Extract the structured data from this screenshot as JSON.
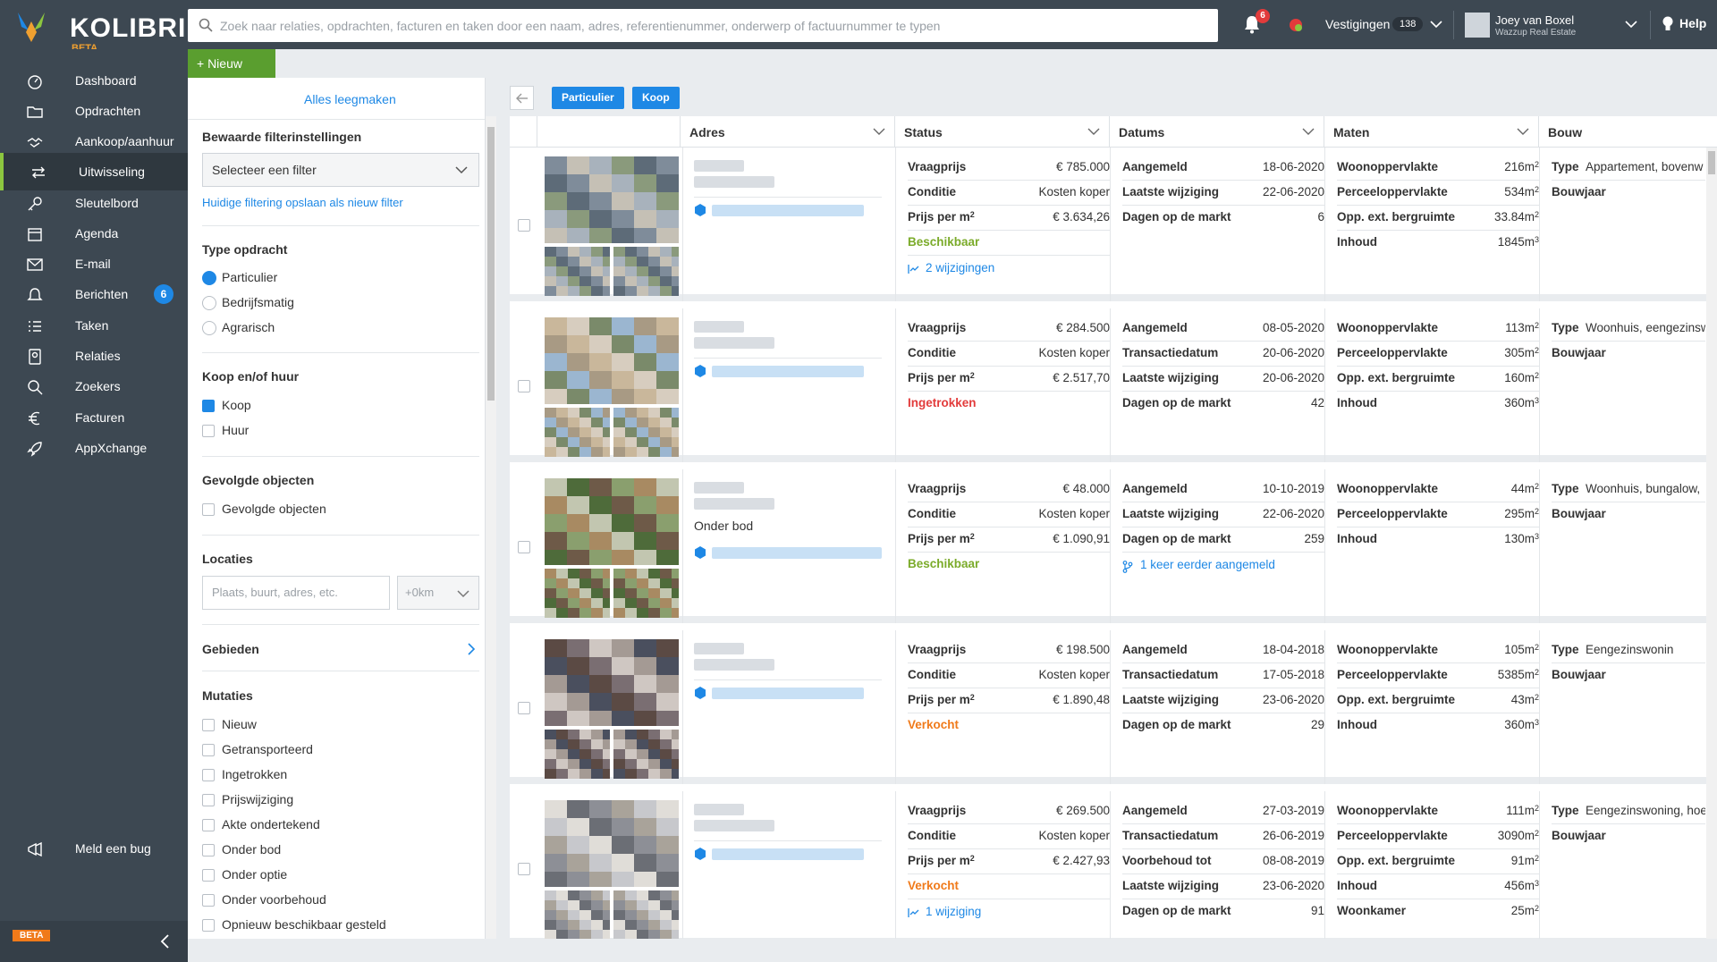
{
  "app": {
    "name": "KOLIBRI",
    "beta": "BETA"
  },
  "search": {
    "placeholder": "Zoek naar relaties, opdrachten, facturen en taken door een naam, adres, referentienummer, onderwerp of factuurnummer te typen"
  },
  "topbar": {
    "notification_count": "6",
    "vestigingen_label": "Vestigingen",
    "vestigingen_count": "138",
    "user_name": "Joey van Boxel",
    "user_company": "Wazzup Real Estate",
    "help": "Help"
  },
  "sidebar": {
    "items": [
      {
        "label": "Dashboard",
        "icon": "dashboard-icon"
      },
      {
        "label": "Opdrachten",
        "icon": "folder-icon"
      },
      {
        "label": "Aankoop/aanhuur",
        "icon": "handshake-icon"
      },
      {
        "label": "Uitwisseling",
        "icon": "exchange-icon"
      },
      {
        "label": "Sleutelbord",
        "icon": "key-icon"
      },
      {
        "label": "Agenda",
        "icon": "calendar-icon"
      },
      {
        "label": "E-mail",
        "icon": "mail-icon"
      },
      {
        "label": "Berichten",
        "icon": "bell-icon",
        "count": "6"
      },
      {
        "label": "Taken",
        "icon": "tasks-icon"
      },
      {
        "label": "Relaties",
        "icon": "contacts-icon"
      },
      {
        "label": "Zoekers",
        "icon": "search-icon"
      },
      {
        "label": "Facturen",
        "icon": "euro-icon"
      },
      {
        "label": "AppXchange",
        "icon": "rocket-icon"
      }
    ],
    "bug": "Meld een bug",
    "beta_flag": "BETA"
  },
  "new_button": "+ Nieuw",
  "filter": {
    "clear": "Alles leegmaken",
    "saved_title": "Bewaarde filterinstellingen",
    "saved_select": "Selecteer een filter",
    "save_link": "Huidige filtering opslaan als nieuw filter",
    "type_title": "Type opdracht",
    "type_options": [
      "Particulier",
      "Bedrijfsmatig",
      "Agrarisch"
    ],
    "koop_title": "Koop en/of huur",
    "koop_options": [
      "Koop",
      "Huur"
    ],
    "gevolgd_title": "Gevolgde objecten",
    "gevolgd_option": "Gevolgde objecten",
    "loc_title": "Locaties",
    "loc_placeholder": "Plaats, buurt, adres, etc.",
    "loc_km": "+0km",
    "gebieden": "Gebieden",
    "mutaties_title": "Mutaties",
    "mutaties": [
      "Nieuw",
      "Getransporteerd",
      "Ingetrokken",
      "Prijswijziging",
      "Akte ondertekend",
      "Onder bod",
      "Onder optie",
      "Onder voorbehoud",
      "Opnieuw beschikbaar gesteld"
    ]
  },
  "chips": [
    "Particulier",
    "Koop"
  ],
  "columns": [
    "Adres",
    "Status",
    "Datums",
    "Maten",
    "Bouw"
  ],
  "rows": [
    {
      "extra_line": "",
      "status": [
        [
          "Vraagprijs",
          "€ 785.000"
        ],
        [
          "Conditie",
          "Kosten koper"
        ],
        [
          "Prijs per m",
          "€ 3.634,26"
        ]
      ],
      "status_label": "Beschikbaar",
      "status_color": "green",
      "status_link": "2 wijzigingen",
      "dates": [
        [
          "Aangemeld",
          "18-06-2020"
        ],
        [
          "Laatste wijziging",
          "22-06-2020"
        ],
        [
          "Dagen op de markt",
          "6"
        ]
      ],
      "date_link": "",
      "sizes": [
        [
          "Woonoppervlakte",
          "216m",
          "2"
        ],
        [
          "Perceeloppervlakte",
          "534m",
          "2"
        ],
        [
          "Opp. ext. bergruimte",
          "33.84m",
          "2"
        ],
        [
          "Inhoud",
          "1845m",
          "3"
        ]
      ],
      "bouw_type_label": "Type",
      "bouw_type": "Appartement, bovenw",
      "bouwjaar": "Bouwjaar"
    },
    {
      "extra_line": "",
      "status": [
        [
          "Vraagprijs",
          "€ 284.500"
        ],
        [
          "Conditie",
          "Kosten koper"
        ],
        [
          "Prijs per m",
          "€ 2.517,70"
        ]
      ],
      "status_label": "Ingetrokken",
      "status_color": "red",
      "status_link": "",
      "dates": [
        [
          "Aangemeld",
          "08-05-2020"
        ],
        [
          "Transactiedatum",
          "20-06-2020"
        ],
        [
          "Laatste wijziging",
          "20-06-2020"
        ],
        [
          "Dagen op de markt",
          "42"
        ]
      ],
      "date_link": "",
      "sizes": [
        [
          "Woonoppervlakte",
          "113m",
          "2"
        ],
        [
          "Perceeloppervlakte",
          "305m",
          "2"
        ],
        [
          "Opp. ext. bergruimte",
          "160m",
          "2"
        ],
        [
          "Inhoud",
          "360m",
          "3"
        ]
      ],
      "bouw_type_label": "Type",
      "bouw_type": "Woonhuis, eengezinsw",
      "bouwjaar": "Bouwjaar"
    },
    {
      "extra_line": "Onder bod",
      "status": [
        [
          "Vraagprijs",
          "€ 48.000"
        ],
        [
          "Conditie",
          "Kosten koper"
        ],
        [
          "Prijs per m",
          "€ 1.090,91"
        ]
      ],
      "status_label": "Beschikbaar",
      "status_color": "green",
      "status_link": "",
      "dates": [
        [
          "Aangemeld",
          "10-10-2019"
        ],
        [
          "Laatste wijziging",
          "22-06-2020"
        ],
        [
          "Dagen op de markt",
          "259"
        ]
      ],
      "date_link": "1 keer eerder aangemeld",
      "sizes": [
        [
          "Woonoppervlakte",
          "44m",
          "2"
        ],
        [
          "Perceeloppervlakte",
          "295m",
          "2"
        ],
        [
          "Inhoud",
          "130m",
          "3"
        ]
      ],
      "bouw_type_label": "Type",
      "bouw_type": "Woonhuis, bungalow,",
      "bouwjaar": "Bouwjaar"
    },
    {
      "extra_line": "",
      "status": [
        [
          "Vraagprijs",
          "€ 198.500"
        ],
        [
          "Conditie",
          "Kosten koper"
        ],
        [
          "Prijs per m",
          "€ 1.890,48"
        ]
      ],
      "status_label": "Verkocht",
      "status_color": "orange",
      "status_link": "",
      "dates": [
        [
          "Aangemeld",
          "18-04-2018"
        ],
        [
          "Transactiedatum",
          "17-05-2018"
        ],
        [
          "Laatste wijziging",
          "23-06-2020"
        ],
        [
          "Dagen op de markt",
          "29"
        ]
      ],
      "date_link": "",
      "sizes": [
        [
          "Woonoppervlakte",
          "105m",
          "2"
        ],
        [
          "Perceeloppervlakte",
          "5385m",
          "2"
        ],
        [
          "Opp. ext. bergruimte",
          "43m",
          "2"
        ],
        [
          "Inhoud",
          "360m",
          "3"
        ]
      ],
      "bouw_type_label": "Type",
      "bouw_type": "Eengezinswonin",
      "bouwjaar": "Bouwjaar"
    },
    {
      "extra_line": "",
      "status": [
        [
          "Vraagprijs",
          "€ 269.500"
        ],
        [
          "Conditie",
          "Kosten koper"
        ],
        [
          "Prijs per m",
          "€ 2.427,93"
        ]
      ],
      "status_label": "Verkocht",
      "status_color": "orange",
      "status_link": "1 wijziging",
      "dates": [
        [
          "Aangemeld",
          "27-03-2019"
        ],
        [
          "Transactiedatum",
          "26-06-2019"
        ],
        [
          "Voorbehoud tot",
          "08-08-2019"
        ],
        [
          "Laatste wijziging",
          "23-06-2020"
        ],
        [
          "Dagen op de markt",
          "91"
        ]
      ],
      "date_link": "",
      "sizes": [
        [
          "Woonoppervlakte",
          "111m",
          "2"
        ],
        [
          "Perceeloppervlakte",
          "3090m",
          "2"
        ],
        [
          "Opp. ext. bergruimte",
          "91m",
          "2"
        ],
        [
          "Inhoud",
          "456m",
          "3"
        ],
        [
          "Woonkamer",
          "25m",
          "2"
        ]
      ],
      "bouw_type_label": "Type",
      "bouw_type": "Eengezinswoning, hoe",
      "bouwjaar": "Bouwjaar"
    }
  ]
}
